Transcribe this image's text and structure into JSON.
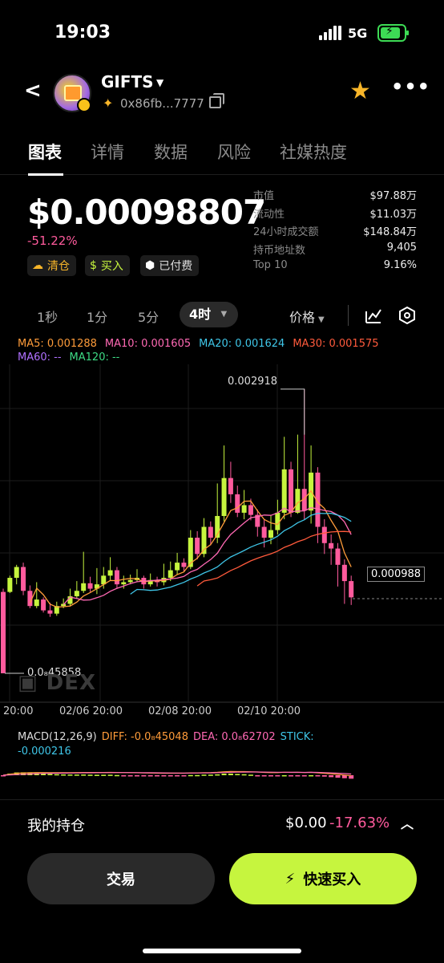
{
  "status": {
    "time": "19:03",
    "network": "5G"
  },
  "header": {
    "token_name": "GIFTS",
    "address": "0x86fb...7777",
    "icons": {
      "back": "chevron-left-icon",
      "favorite": "star-icon",
      "more": "more-icon",
      "copy": "copy-icon",
      "chain": "chain-icon"
    }
  },
  "tabs": [
    "图表",
    "详情",
    "数据",
    "风险",
    "社媒热度"
  ],
  "price": {
    "value": "$0.00098807",
    "change": "-51.22%"
  },
  "chips": {
    "clear": "清仓",
    "buy": "买入",
    "paid": "已付费"
  },
  "stats": [
    {
      "k": "市值",
      "v": "$97.88万"
    },
    {
      "k": "流动性",
      "v": "$11.03万"
    },
    {
      "k": "24小时成交额",
      "v": "$148.84万"
    },
    {
      "k": "持币地址数",
      "v": "9,405"
    },
    {
      "k": "Top 10",
      "v": "9.16%"
    }
  ],
  "intervals": [
    "1秒",
    "1分",
    "5分",
    "4时"
  ],
  "price_type": "价格",
  "ma_legend": {
    "ma5": "MA5: 0.001288",
    "ma10": "MA10: 0.001605",
    "ma20": "MA20: 0.001624",
    "ma30": "MA30: 0.001575",
    "ma60": "MA60: --",
    "ma120": "MA120: --"
  },
  "chart": {
    "high_label": "0.002918",
    "low_label": "0.0₈4585 8",
    "current_label": "0.000988",
    "watermark": "DEX",
    "x_labels": [
      "20:00",
      "02/06 20:00",
      "02/08 20:00",
      "02/10 20:00"
    ]
  },
  "macd_legend": {
    "name": "MACD(12,26,9)",
    "diff": "DIFF: -0.0₈4504 8",
    "dea": "DEA: 0.0₈6270 2",
    "stick": "STICK:",
    "stick_value": "-0.000216"
  },
  "holdings": {
    "label": "我的持仓",
    "value": "$0.00",
    "pct": "-17.63%"
  },
  "buttons": {
    "trade": "交易",
    "quick_buy": "快速买入"
  },
  "colors": {
    "up": "#c6f53e",
    "down": "#ff5b9d",
    "accent": "#c6f53e",
    "star": "#f7b529"
  },
  "chart_data": {
    "type": "candlestick",
    "high": 0.002918,
    "current": 0.000988,
    "candles": [
      [
        0.00105,
        0.0003,
        0.00108,
        0.0003
      ],
      [
        0.00105,
        0.00118,
        0.0012,
        0.00104
      ],
      [
        0.00118,
        0.00128,
        0.0013,
        0.00112
      ],
      [
        0.00128,
        0.00106,
        0.00132,
        0.00102
      ],
      [
        0.00106,
        0.00092,
        0.00111,
        0.0009
      ],
      [
        0.00092,
        0.00098,
        0.00114,
        0.0009
      ],
      [
        0.00098,
        0.00088,
        0.001,
        0.00086
      ],
      [
        0.00088,
        0.00085,
        0.00095,
        0.00082
      ],
      [
        0.00085,
        0.00092,
        0.00096,
        0.00083
      ],
      [
        0.00092,
        0.00094,
        0.00099,
        0.0009
      ],
      [
        0.00094,
        0.00101,
        0.00108,
        0.00092
      ],
      [
        0.00101,
        0.00106,
        0.00115,
        0.00099
      ],
      [
        0.00106,
        0.00113,
        0.00142,
        0.00104
      ],
      [
        0.00113,
        0.00108,
        0.00119,
        0.00105
      ],
      [
        0.00108,
        0.00112,
        0.00127,
        0.00103
      ],
      [
        0.00112,
        0.0012,
        0.00128,
        0.00108
      ],
      [
        0.0012,
        0.00125,
        0.00137,
        0.00116
      ],
      [
        0.00125,
        0.00112,
        0.00128,
        0.00108
      ],
      [
        0.00112,
        0.00114,
        0.0012,
        0.00108
      ],
      [
        0.00114,
        0.00116,
        0.00121,
        0.00112
      ],
      [
        0.00116,
        0.00118,
        0.00126,
        0.00114
      ],
      [
        0.00118,
        0.00112,
        0.0012,
        0.00108
      ],
      [
        0.00112,
        0.00116,
        0.00122,
        0.0011
      ],
      [
        0.00116,
        0.00114,
        0.00119,
        0.0011
      ],
      [
        0.00114,
        0.00118,
        0.00131,
        0.00111
      ],
      [
        0.00118,
        0.00125,
        0.00133,
        0.00115
      ],
      [
        0.00125,
        0.00132,
        0.00141,
        0.00121
      ],
      [
        0.00132,
        0.00128,
        0.00136,
        0.00124
      ],
      [
        0.00128,
        0.00155,
        0.00162,
        0.00126
      ],
      [
        0.00155,
        0.0014,
        0.00161,
        0.00135
      ],
      [
        0.0014,
        0.00165,
        0.00173,
        0.00137
      ],
      [
        0.00165,
        0.00155,
        0.0017,
        0.00148
      ],
      [
        0.00155,
        0.00175,
        0.00205,
        0.0015
      ],
      [
        0.00175,
        0.0021,
        0.0024,
        0.0017
      ],
      [
        0.0021,
        0.00195,
        0.00225,
        0.00187
      ],
      [
        0.00195,
        0.00178,
        0.00203,
        0.00174
      ],
      [
        0.00178,
        0.00185,
        0.00199,
        0.00172
      ],
      [
        0.00185,
        0.00176,
        0.00191,
        0.00171
      ],
      [
        0.00176,
        0.00165,
        0.00181,
        0.00156
      ],
      [
        0.00165,
        0.00155,
        0.00172,
        0.00146
      ],
      [
        0.00155,
        0.00162,
        0.00176,
        0.00149
      ],
      [
        0.00162,
        0.00178,
        0.0019,
        0.00158
      ],
      [
        0.00178,
        0.00218,
        0.00248,
        0.00172
      ],
      [
        0.00218,
        0.00178,
        0.00225,
        0.00174
      ],
      [
        0.00178,
        0.002,
        0.0025,
        0.00177
      ],
      [
        0.002,
        0.0018,
        0.00292,
        0.00172
      ],
      [
        0.0018,
        0.00215,
        0.0024,
        0.00168
      ],
      [
        0.00215,
        0.00165,
        0.0022,
        0.0015
      ],
      [
        0.00165,
        0.0015,
        0.00172,
        0.0014
      ],
      [
        0.0015,
        0.00145,
        0.00158,
        0.0013
      ],
      [
        0.00145,
        0.0013,
        0.0015,
        0.0011
      ],
      [
        0.0013,
        0.00115,
        0.00135,
        0.00094
      ],
      [
        0.00115,
        0.001,
        0.0012,
        0.00093
      ]
    ]
  }
}
